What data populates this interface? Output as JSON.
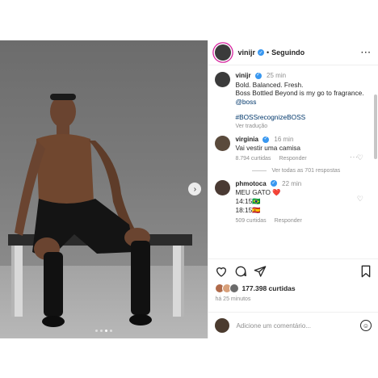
{
  "header": {
    "username": "vinijr",
    "separator": "•",
    "follow_status": "Seguindo",
    "more": "···"
  },
  "caption": {
    "username": "vinijr",
    "time": "25 min",
    "lines": [
      "Bold. Balanced. Fresh.",
      "Boss Bottled Beyond is my go to fragrance."
    ],
    "mention": "@boss",
    "hashtag": "#BOSSrecognizeBOSS",
    "translate": "Ver tradução"
  },
  "comments": [
    {
      "username": "virginia",
      "time": "16 min",
      "text": "Vai vestir uma camisa",
      "likes": "8.794 curtidas",
      "reply": "Responder",
      "view_replies": "Ver todas as 701 respostas"
    },
    {
      "username": "phmotoca",
      "time": "22 min",
      "line1": "MEU GATO ❤️",
      "line2": "14:15🇧🇷",
      "line3": "18:15🇪🇸",
      "likes": "509 curtidas",
      "reply": "Responder"
    }
  ],
  "actions": {
    "likes_count": "177.398 curtidas",
    "posted_ago": "há 25 minutos"
  },
  "composer": {
    "placeholder": "Adicione um comentário..."
  },
  "carousel": {
    "slides": 4,
    "active_index": 2
  },
  "colors": {
    "verified": "#3897f0",
    "link": "#00376b",
    "heart": "#ed4956"
  }
}
